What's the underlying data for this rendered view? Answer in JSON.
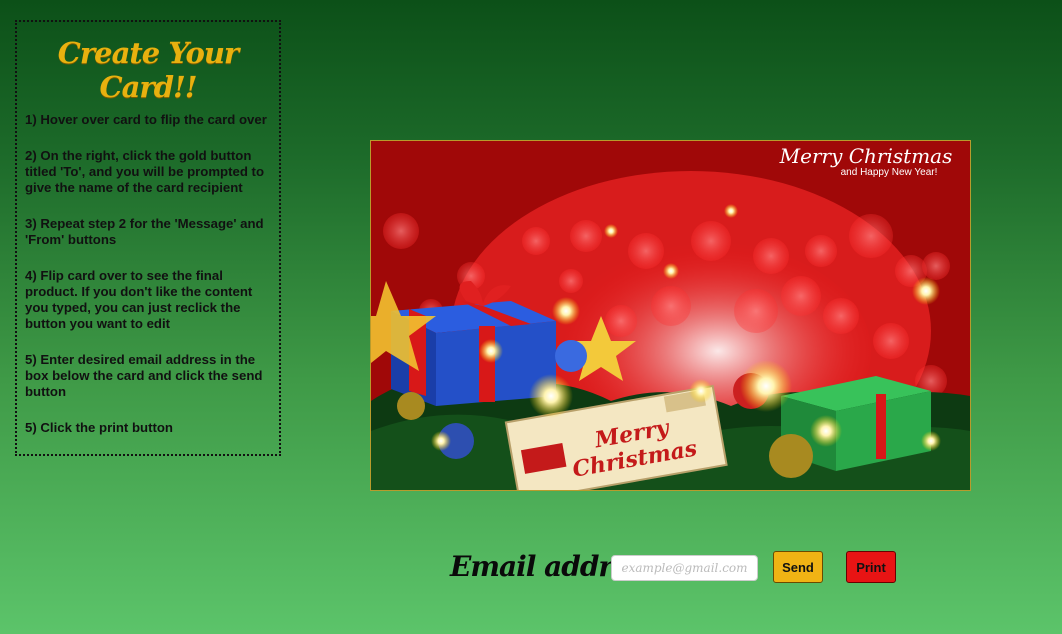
{
  "sidebar": {
    "title": "Create Your Card!!",
    "steps": [
      "1) Hover over card to flip the card over",
      "2) On the right, click the gold button titled 'To', and you will be prompted to give the name of the card recipient",
      "3) Repeat step 2 for the 'Message' and 'From' buttons",
      "4) Flip card over to see the final product. If you don't like the content you typed, you can just reclick the button you want to edit",
      "5) Enter desired email address in the box below the card and click the send button",
      "5) Click the print button"
    ]
  },
  "card": {
    "greeting": "Merry Christmas",
    "subgreeting": "and Happy New Year!",
    "tag_text_line1": "Merry",
    "tag_text_line2": "Christmas"
  },
  "email": {
    "label": "Email address:",
    "placeholder": "example@gmail.com",
    "value": ""
  },
  "buttons": {
    "send_label": "Send",
    "print_label": "Print"
  },
  "colors": {
    "title_gold": "#e8b10f",
    "send_button": "#f0b314",
    "print_button": "#e81414"
  }
}
